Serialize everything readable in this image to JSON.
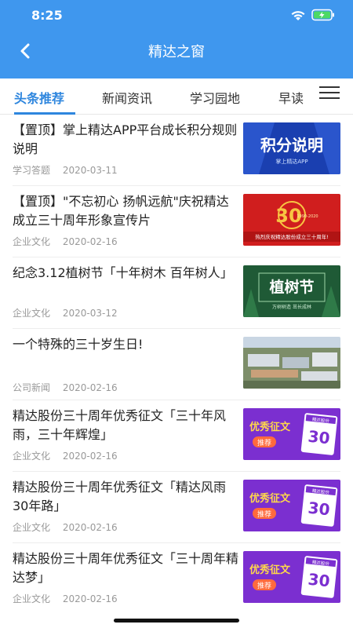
{
  "status": {
    "time": "8:25"
  },
  "nav": {
    "title": "精达之窗"
  },
  "tabs": [
    "头条推荐",
    "新闻资讯",
    "学习园地",
    "早读"
  ],
  "articles": [
    {
      "title": "【置顶】掌上精达APP平台成长积分规则说明",
      "category": "学习答题",
      "date": "2020-03-11",
      "thumb_text": "积分说明",
      "thumb_sub": "掌上精达APP"
    },
    {
      "title": "【置顶】\"不忘初心  扬帆远航\"庆祝精达成立三十周年形象宣传片",
      "category": "企业文化",
      "date": "2020-02-16",
      "thumb_text": "30",
      "thumb_sub": "热烈庆祝精达股份成立三十周年!",
      "thumb_years": "1990-2020"
    },
    {
      "title": "纪念3.12植树节「十年树木  百年树人」",
      "category": "企业文化",
      "date": "2020-03-12",
      "thumb_text": "植树节",
      "thumb_sub": "万树树造  茁长成林"
    },
    {
      "title": "一个特殊的三十岁生日!",
      "category": "公司新闻",
      "date": "2020-02-16"
    },
    {
      "title": "精达股份三十周年优秀征文「三十年风雨，三十年辉煌」",
      "category": "企业文化",
      "date": "2020-02-16",
      "thumb_text": "优秀征文",
      "thumb_sub": "推荐",
      "thumb_num": "30",
      "thumb_cal": "精达股份"
    },
    {
      "title": "精达股份三十周年优秀征文「精达风雨30年路」",
      "category": "企业文化",
      "date": "2020-02-16",
      "thumb_text": "优秀征文",
      "thumb_sub": "推荐",
      "thumb_num": "30",
      "thumb_cal": "精达股份"
    },
    {
      "title": "精达股份三十周年优秀征文「三十周年精达梦」",
      "category": "企业文化",
      "date": "2020-02-16",
      "thumb_text": "优秀征文",
      "thumb_sub": "推荐",
      "thumb_num": "30",
      "thumb_cal": "精达股份"
    }
  ],
  "colors": {
    "header": "#3f97ee",
    "active_tab": "#2e86de",
    "meta": "#999999"
  }
}
